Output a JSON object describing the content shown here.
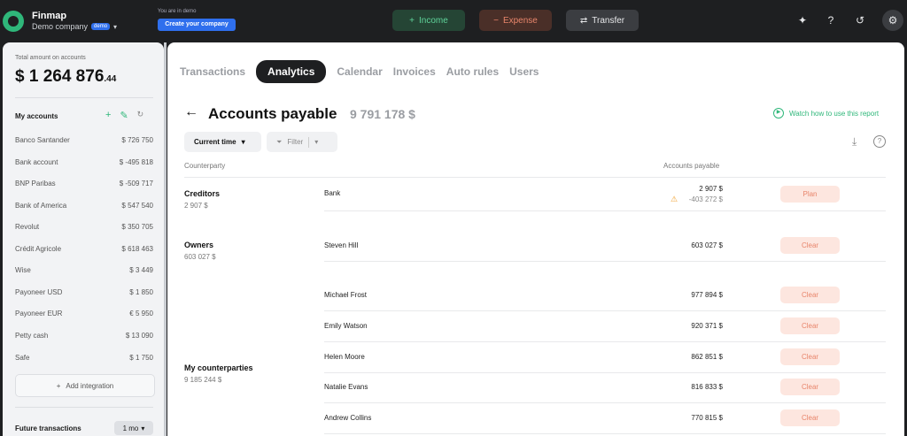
{
  "topbar": {
    "brand": "Finmap",
    "company": "Demo company",
    "demo_badge": "demo",
    "demo_note": "You are in demo",
    "create_company": "Create your company",
    "income_label": "Income",
    "expense_label": "Expense",
    "transfer_label": "Transfer"
  },
  "sidebar": {
    "total_label": "Total amount on accounts",
    "total_currency": "$",
    "total_main": "1 264 876",
    "total_cents": ".44",
    "my_accounts_title": "My accounts",
    "accounts": [
      {
        "name": "Banco Santander",
        "amount": "$ 726 750"
      },
      {
        "name": "Bank account",
        "amount": "$ -495 818"
      },
      {
        "name": "BNP Paribas",
        "amount": "$ -509 717"
      },
      {
        "name": "Bank of America",
        "amount": "$ 547 540"
      },
      {
        "name": "Revolut",
        "amount": "$ 350 705"
      },
      {
        "name": "Crédit Agricole",
        "amount": "$ 618 463"
      },
      {
        "name": "Wise",
        "amount": "$ 3 449"
      },
      {
        "name": "Payoneer USD",
        "amount": "$ 1 850"
      },
      {
        "name": "Payoneer EUR",
        "amount": "€ 5 950"
      },
      {
        "name": "Petty cash",
        "amount": "$ 13 090"
      },
      {
        "name": "Safe",
        "amount": "$ 1 750"
      }
    ],
    "add_integration": "Add integration",
    "future_title": "Future transactions",
    "future_period": "1 mo"
  },
  "main": {
    "tabs": [
      "Transactions",
      "Analytics",
      "Calendar",
      "Invoices",
      "Auto rules",
      "Users"
    ],
    "active_tab": "Analytics",
    "title": "Accounts payable",
    "title_total": "9 791 178 $",
    "watch_link": "Watch how to use this report",
    "time_filter": "Current time",
    "filter_label": "Filter",
    "col_counterparty": "Counterparty",
    "col_payable": "Accounts payable",
    "groups": [
      {
        "name": "Creditors",
        "sum": "2 907 $"
      },
      {
        "name": "Owners",
        "sum": "603 027 $"
      },
      {
        "name": "My counterparties",
        "sum": "9 185 244 $"
      }
    ],
    "rows": [
      {
        "name": "Bank",
        "amount": "2 907 $",
        "amount2": "-403 272 $",
        "status": "Plan"
      },
      {
        "name": "Steven Hill",
        "amount": "603 027 $",
        "status": "Clear"
      },
      {
        "name": "Michael Frost",
        "amount": "977 894 $",
        "status": "Clear"
      },
      {
        "name": "Emily Watson",
        "amount": "920 371 $",
        "status": "Clear"
      },
      {
        "name": "Helen Moore",
        "amount": "862 851 $",
        "status": "Clear"
      },
      {
        "name": "Natalie Evans",
        "amount": "816 833 $",
        "status": "Clear"
      },
      {
        "name": "Andrew Collins",
        "amount": "770 815 $",
        "status": "Clear"
      }
    ]
  },
  "colors": {
    "accent_green": "#2fb77a",
    "accent_blue": "#2f6fed",
    "status_bg": "#fde6df",
    "status_text": "#e8856b"
  }
}
